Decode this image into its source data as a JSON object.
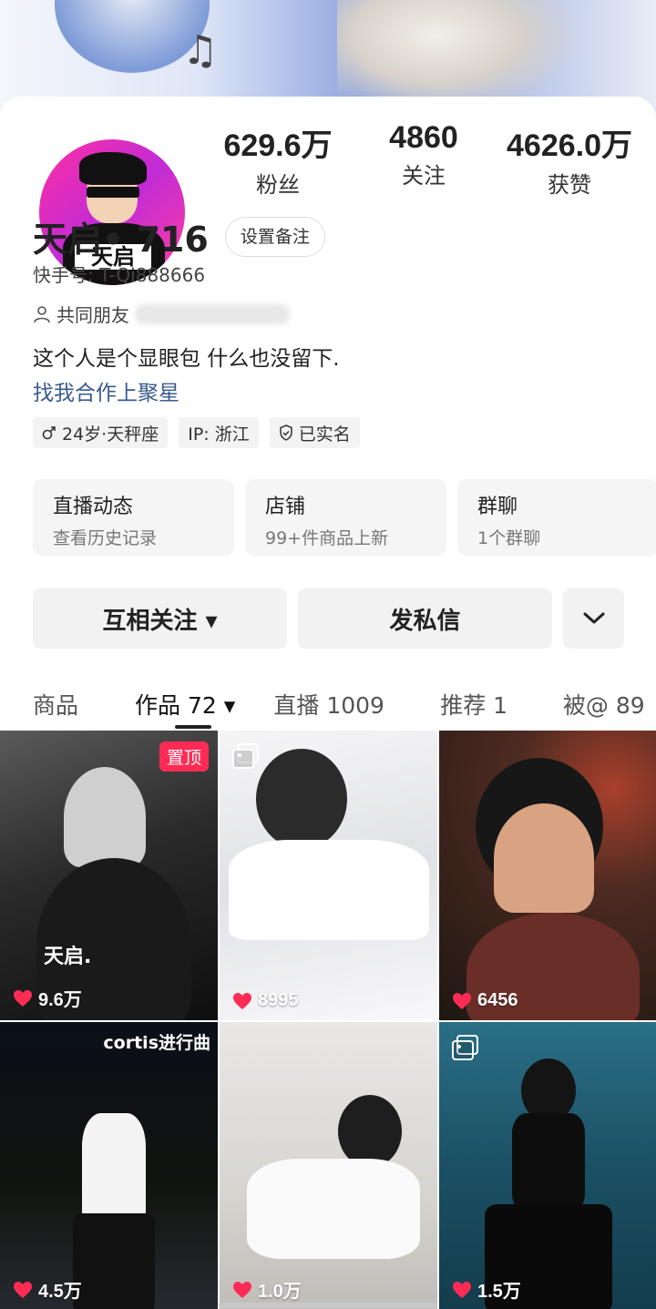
{
  "profile": {
    "name": "天启• 716",
    "remark_button": "设置备注",
    "kuaishou_id": "快手号: T-Qi888666",
    "mutual_friends": "共同朋友",
    "bio": "这个人是个显眼包 什么也没留下.",
    "link": "找我合作上聚星",
    "avatar_badge": "天启"
  },
  "stats": [
    {
      "value": "629.6万",
      "label": "粉丝"
    },
    {
      "value": "4860",
      "label": "关注"
    },
    {
      "value": "4626.0万",
      "label": "获赞"
    }
  ],
  "tags": [
    {
      "icon": "male-icon",
      "text": "24岁·天秤座"
    },
    {
      "icon": "",
      "text": "IP: 浙江"
    },
    {
      "icon": "verified-shield-icon",
      "text": "已实名"
    }
  ],
  "cards": [
    {
      "title": "直播动态",
      "subtitle": "查看历史记录"
    },
    {
      "title": "店铺",
      "subtitle": "99+件商品上新"
    },
    {
      "title": "群聊",
      "subtitle": "1个群聊"
    }
  ],
  "actions": {
    "follow": "互相关注 ▾",
    "message": "发私信"
  },
  "tabs": [
    {
      "label": "商品"
    },
    {
      "label": "作品 72 ▾"
    },
    {
      "label": "直播 1009"
    },
    {
      "label": "推荐 1"
    },
    {
      "label": "被@ 89"
    }
  ],
  "grid": [
    {
      "likes": "9.6万",
      "pinned": "置顶",
      "overlay": "天启.",
      "corner": ""
    },
    {
      "likes": "8995",
      "pinned": "",
      "overlay": "",
      "corner": ""
    },
    {
      "likes": "6456",
      "pinned": "",
      "overlay": "",
      "corner": ""
    },
    {
      "likes": "4.5万",
      "pinned": "",
      "overlay": "",
      "corner": "cortis进行曲"
    },
    {
      "likes": "1.0万",
      "pinned": "",
      "overlay": "",
      "corner": ""
    },
    {
      "likes": "1.5万",
      "pinned": "",
      "overlay": "",
      "corner": ""
    }
  ],
  "colors": {
    "accent": "#fe2c55",
    "link": "#3a5a92"
  }
}
